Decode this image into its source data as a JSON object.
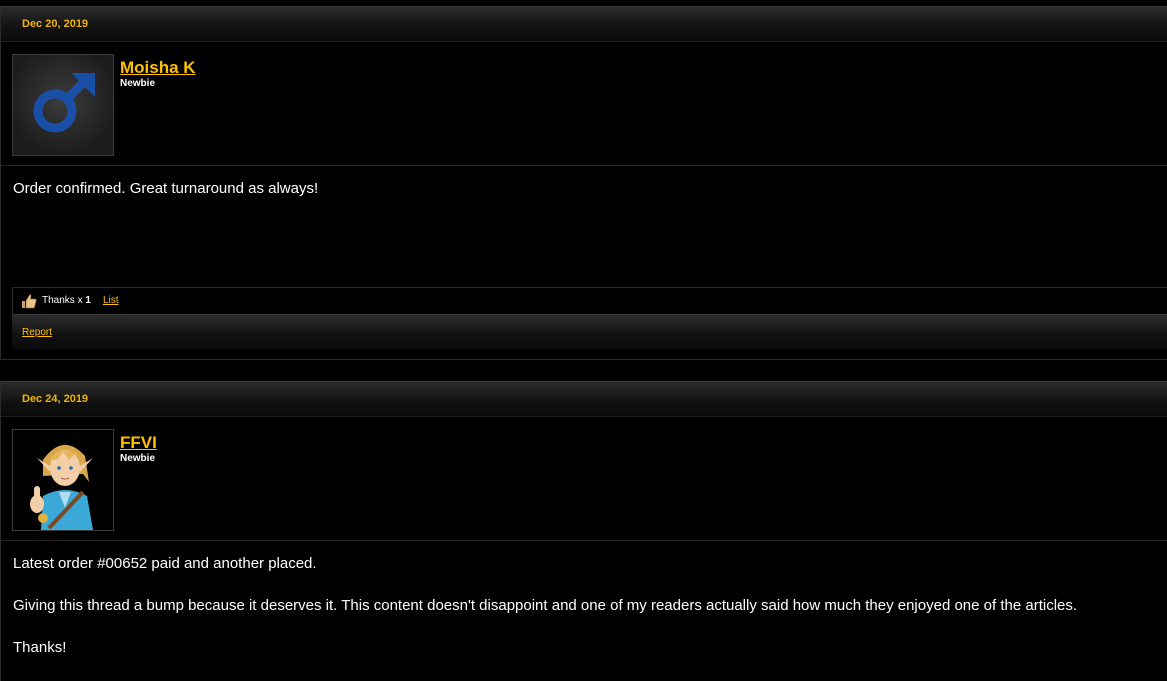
{
  "posts": [
    {
      "date": "Dec 20, 2019",
      "author": "Moisha K",
      "author_title": "Newbie",
      "avatar_icon": "male-symbol-icon",
      "paragraphs": [
        "Order confirmed. Great turnaround as always!"
      ],
      "likes": {
        "label": "Thanks x ",
        "count": "1",
        "list_label": "List"
      },
      "report_label": "Report"
    },
    {
      "date": "Dec 24, 2019",
      "author": "FFVI",
      "author_title": "Newbie",
      "avatar_icon": "link-character-thumbs-up-avatar",
      "paragraphs": [
        "Latest order #00652 paid and another placed.",
        "Giving this thread a bump because it deserves it. This content doesn't disappoint and one of my readers actually said how much they enjoyed one of the articles.",
        "Thanks!"
      ]
    }
  ],
  "colors": {
    "accent": "#ffc000",
    "background": "#000000",
    "text": "#ffffff",
    "avatar_symbol": "#1a4fa8"
  }
}
